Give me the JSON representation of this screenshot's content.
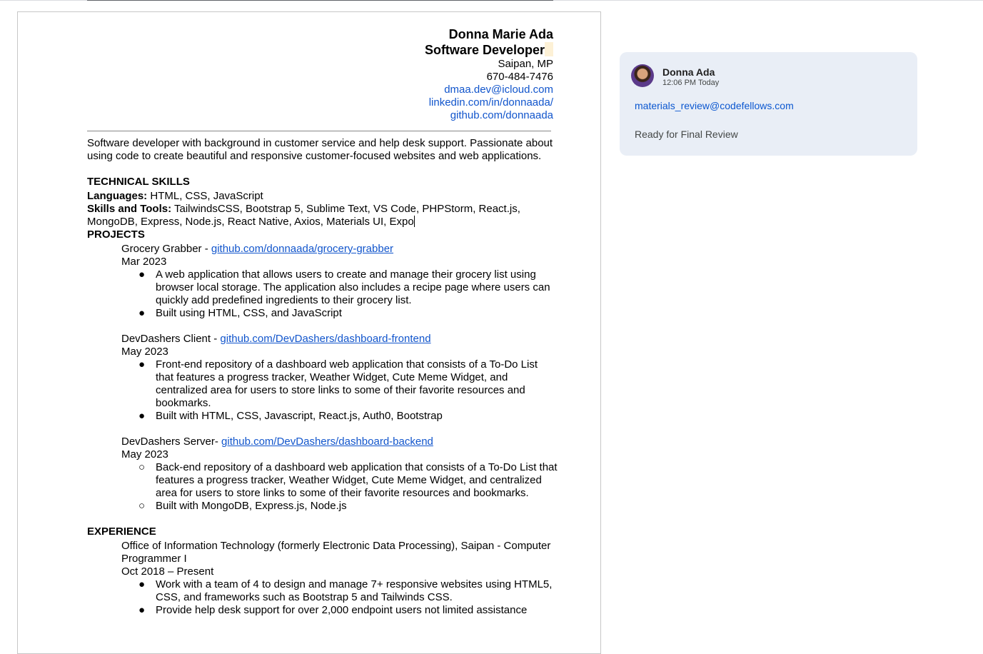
{
  "header": {
    "name": "Donna Marie Ada",
    "title": "Software Developer",
    "location": "Saipan, MP",
    "phone": "670-484-7476",
    "email": "dmaa.dev@icloud.com",
    "linkedin": "linkedin.com/in/donnaada/",
    "github": "github.com/donnaada"
  },
  "summary": "Software developer with background in customer service and help desk support. Passionate about using code to create beautiful and responsive customer-focused websites and web applications.",
  "skills": {
    "heading": "TECHNICAL SKILLS",
    "languages_label": "Languages:",
    "languages": " HTML, CSS, JavaScript",
    "tools_label": "Skills and Tools:",
    "tools": " TailwindsCSS, Bootstrap 5, Sublime Text, VS Code, PHPStorm, React.js, MongoDB, Express, Node.js, React Native, Axios, Materials UI, Expo"
  },
  "projects": {
    "heading": "PROJECTS",
    "items": [
      {
        "name": "Grocery Grabber - ",
        "link": "github.com/donnaada/grocery-grabber",
        "date": "Mar 2023",
        "marker": "●",
        "bullets": [
          "A web application that allows users to create and manage their grocery list using browser local storage. The application also includes a recipe page where users can quickly add predefined ingredients to their grocery list.",
          "Built using HTML, CSS, and JavaScript"
        ]
      },
      {
        "name": "DevDashers Client - ",
        "link": "github.com/DevDashers/dashboard-frontend",
        "date": "May 2023",
        "marker": "●",
        "bullets": [
          "Front-end repository of a dashboard web application that consists of a To-Do List that features a progress tracker, Weather Widget, Cute Meme Widget, and centralized area for  users to store links to some of their favorite resources and bookmarks.",
          "Built with HTML, CSS, Javascript, React.js, Auth0, Bootstrap"
        ]
      },
      {
        "name": "DevDashers Server- ",
        "link": "github.com/DevDashers/dashboard-backend",
        "date": "May 2023",
        "marker": "○",
        "bullets": [
          "Back-end repository of a dashboard web application that consists of a To-Do List that features a progress tracker, Weather Widget, Cute Meme Widget, and centralized area for  users to store links to some of their favorite resources and bookmarks.",
          "Built with MongoDB, Express.js, Node.js"
        ]
      }
    ]
  },
  "experience": {
    "heading": "EXPERIENCE",
    "org": "Office of Information Technology (formerly Electronic Data Processing), Saipan - Computer Programmer I",
    "date": "Oct 2018 – Present",
    "marker": "●",
    "bullets": [
      "Work with a team of 4 to design and manage 7+ responsive websites using HTML5, CSS, and frameworks such as Bootstrap 5 and Tailwinds CSS.",
      "Provide help desk support for over 2,000 endpoint users not limited assistance"
    ]
  },
  "comment": {
    "author": "Donna Ada",
    "time": "12:06 PM Today",
    "email": "materials_review@codefellows.com",
    "text": "Ready for Final Review"
  }
}
